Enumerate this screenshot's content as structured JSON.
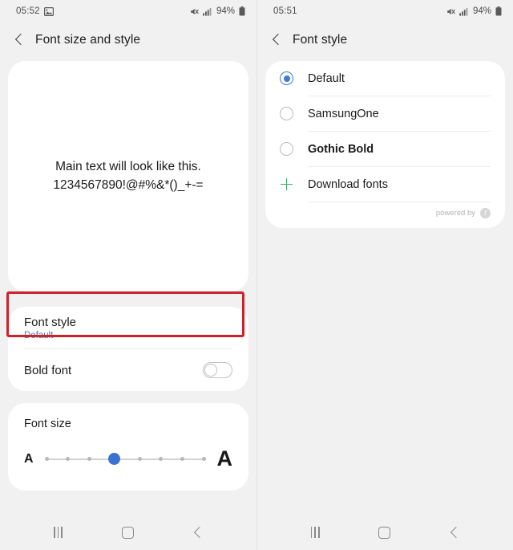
{
  "left": {
    "status": {
      "time": "05:52",
      "image_icon": "image-icon",
      "mute_icon": "mute-icon",
      "signal_icon": "signal-icon",
      "battery_percent": "94%",
      "battery_icon": "battery-icon"
    },
    "appbar": {
      "back_icon": "back-arrow-icon",
      "title": "Font size and style"
    },
    "preview": {
      "line1": "Main text will look like this.",
      "line2": "1234567890!@#%&*()_+-="
    },
    "settings": {
      "font_style": {
        "title": "Font style",
        "value": "Default"
      },
      "bold_font": {
        "title": "Bold font",
        "toggle_state": "off"
      }
    },
    "font_size": {
      "title": "Font size",
      "small_label": "A",
      "large_label": "A",
      "steps": 8,
      "selected_index": 3
    },
    "highlight_color": "#d0202a",
    "nav": {
      "recents": "recent-apps-icon",
      "home": "home-icon",
      "back": "back-icon"
    }
  },
  "right": {
    "status": {
      "time": "05:51",
      "mute_icon": "mute-icon",
      "signal_icon": "signal-icon",
      "battery_percent": "94%",
      "battery_icon": "battery-icon"
    },
    "appbar": {
      "back_icon": "back-arrow-icon",
      "title": "Font style"
    },
    "fonts": [
      {
        "label": "Default",
        "selected": true,
        "bold": false,
        "type": "radio"
      },
      {
        "label": "SamsungOne",
        "selected": false,
        "bold": false,
        "type": "radio"
      },
      {
        "label": "Gothic Bold",
        "selected": false,
        "bold": true,
        "type": "radio"
      },
      {
        "label": "Download fonts",
        "selected": false,
        "bold": false,
        "type": "add"
      }
    ],
    "footer": {
      "text": "powered by",
      "badge": "f"
    },
    "nav": {
      "recents": "recent-apps-icon",
      "home": "home-icon",
      "back": "back-icon"
    }
  },
  "colors": {
    "accent_blue": "#3e7bd4",
    "link_blue": "#4a7ab5",
    "green": "#3fa96b",
    "highlight_red": "#d0202a",
    "bg": "#f1f1f1",
    "card": "#ffffff"
  }
}
